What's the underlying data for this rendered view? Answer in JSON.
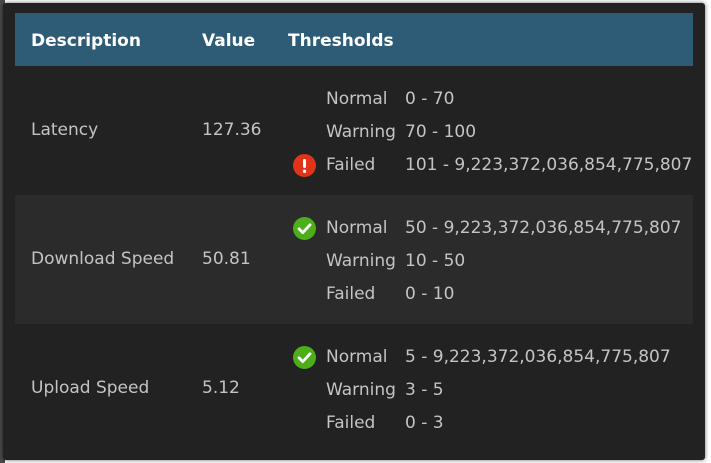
{
  "table": {
    "headers": {
      "description": "Description",
      "value": "Value",
      "thresholds": "Thresholds"
    },
    "rows": [
      {
        "description": "Latency",
        "value": "127.36",
        "thresholds": [
          {
            "name": "Normal",
            "range": "0 - 70",
            "icon": null
          },
          {
            "name": "Warning",
            "range": "70 - 100",
            "icon": null
          },
          {
            "name": "Failed",
            "range": "101 - 9,223,372,036,854,775,807",
            "icon": "error-icon"
          }
        ]
      },
      {
        "description": "Download Speed",
        "value": "50.81",
        "thresholds": [
          {
            "name": "Normal",
            "range": "50 - 9,223,372,036,854,775,807",
            "icon": "check-icon"
          },
          {
            "name": "Warning",
            "range": "10 - 50",
            "icon": null
          },
          {
            "name": "Failed",
            "range": "0 - 10",
            "icon": null
          }
        ]
      },
      {
        "description": "Upload Speed",
        "value": "5.12",
        "thresholds": [
          {
            "name": "Normal",
            "range": "5 - 9,223,372,036,854,775,807",
            "icon": "check-icon"
          },
          {
            "name": "Warning",
            "range": "3 - 5",
            "icon": null
          },
          {
            "name": "Failed",
            "range": "0 - 3",
            "icon": null
          }
        ]
      }
    ]
  },
  "colors": {
    "header_bg": "#2e5c77",
    "panel_bg": "#222222",
    "alt_row_bg": "#2b2b2b",
    "text": "#c4c4c4",
    "ok_green": "#4caf1a",
    "error_red": "#e0341a"
  }
}
